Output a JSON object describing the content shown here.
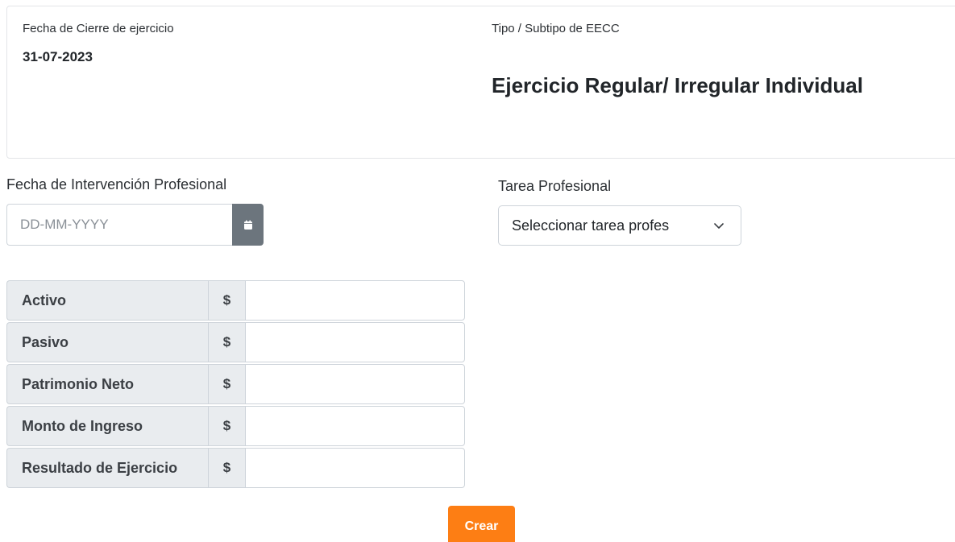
{
  "summary": {
    "cierre_label": "Fecha de Cierre de ejercicio",
    "cierre_value": "31-07-2023",
    "tipo_label": "Tipo / Subtipo de EECC",
    "tipo_value": "Ejercicio Regular/ Irregular Individual"
  },
  "form": {
    "intervencion_label": "Fecha de Intervención Profesional",
    "intervencion_placeholder": "DD-MM-YYYY",
    "intervencion_value": "",
    "tarea_label": "Tarea Profesional",
    "tarea_selected": "Seleccionar tarea profes",
    "calendar_icon": "calendar-icon",
    "chevron_icon": "chevron-down-icon"
  },
  "money_rows": [
    {
      "label": "Activo",
      "currency": "$",
      "value": ""
    },
    {
      "label": "Pasivo",
      "currency": "$",
      "value": ""
    },
    {
      "label": "Patrimonio Neto",
      "currency": "$",
      "value": ""
    },
    {
      "label": "Monto de Ingreso",
      "currency": "$",
      "value": ""
    },
    {
      "label": "Resultado de Ejercicio",
      "currency": "$",
      "value": ""
    }
  ],
  "actions": {
    "crear_label": "Crear"
  },
  "colors": {
    "accent": "#fd7e14",
    "addon_bg": "#e9ecef",
    "calendar_btn": "#6c757d"
  }
}
